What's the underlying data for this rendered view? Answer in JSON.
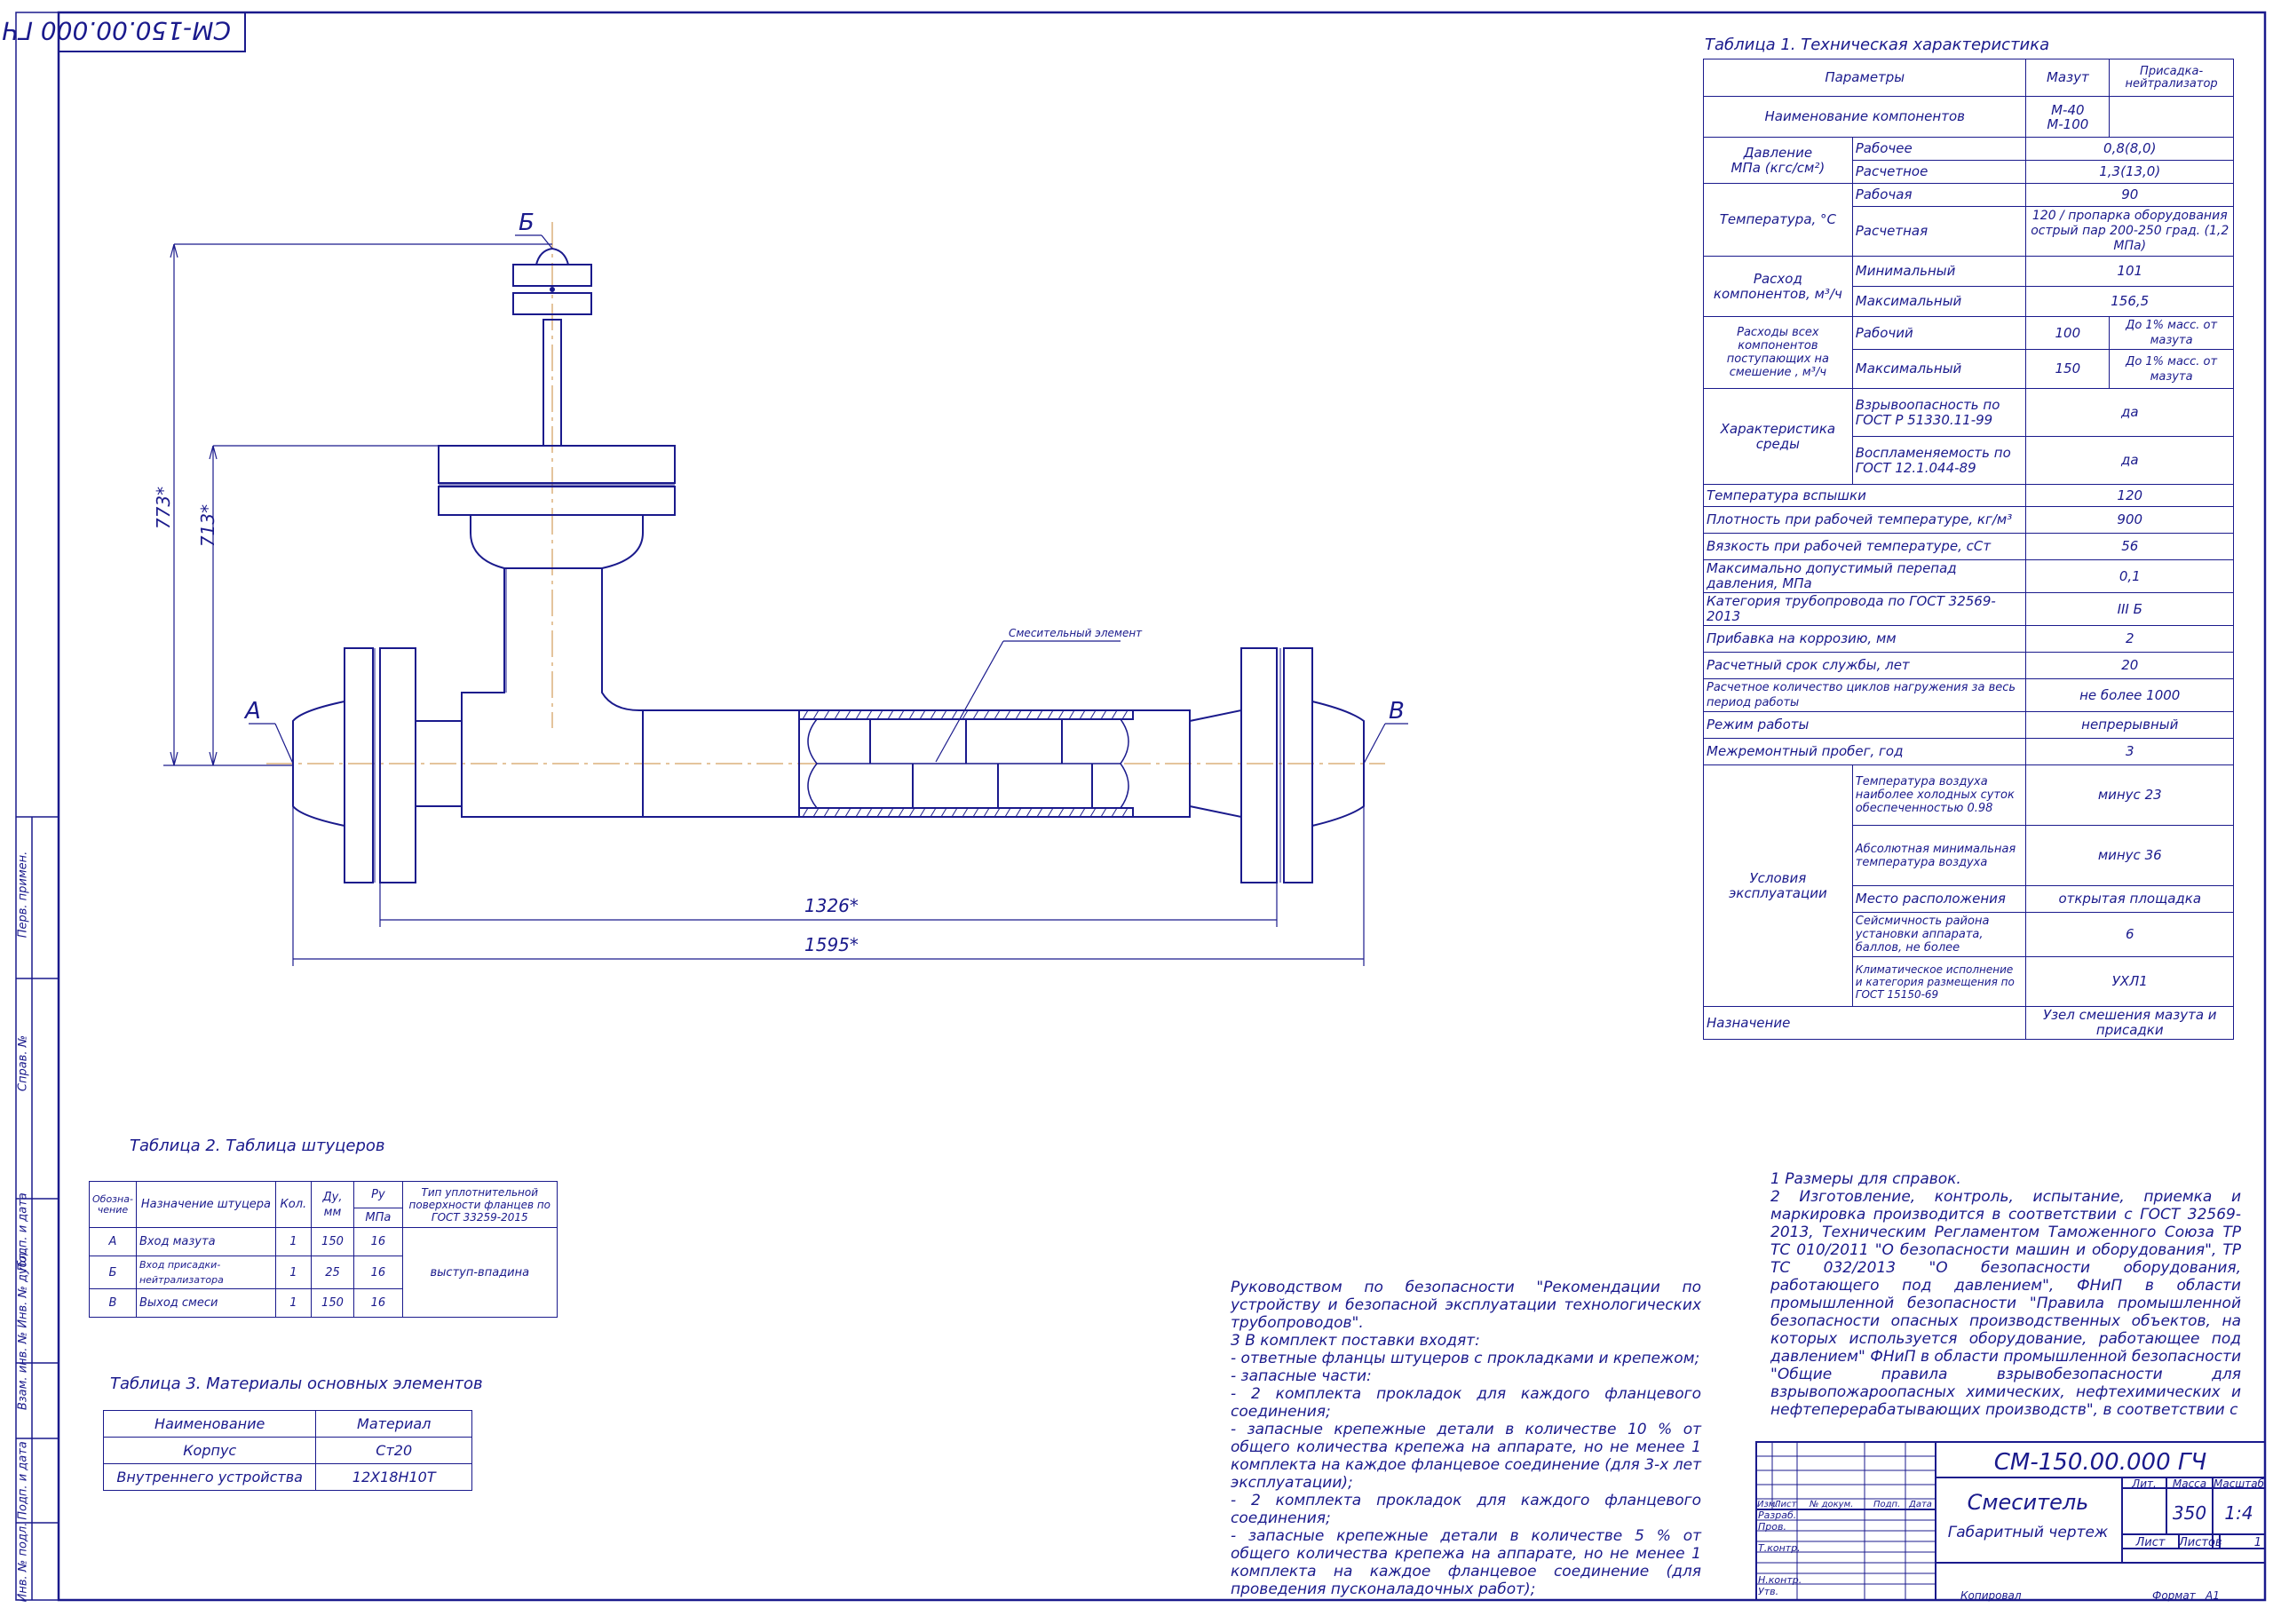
{
  "stamp_rotated": "СМ-150.00.000 ГЧ",
  "drawing": {
    "labels": {
      "a": "А",
      "b": "Б",
      "v": "В"
    },
    "dims": {
      "h1": "773*",
      "h2": "713*",
      "w1": "1326*",
      "w2": "1595*"
    },
    "leader": "Смесительный элемент"
  },
  "side_labels": [
    "Перв. примен.",
    "Справ. №",
    "Подп. и дата",
    "Взам. инв. № Инв. № дубл.",
    "Подп. и дата",
    "Инв. № подл."
  ],
  "table1": {
    "title": "Таблица 1. Техническая характеристика",
    "header": {
      "params": "Параметры",
      "mazut": "Мазут",
      "additive": "Присадка-нейтрализатор"
    },
    "components": {
      "label": "Наименование компонентов",
      "mazut": "М-40\nМ-100"
    },
    "pressure": {
      "label": "Давление\nМПа (кгс/см²)",
      "work": "Рабочее",
      "work_v": "0,8(8,0)",
      "calc": "Расчетное",
      "calc_v": "1,3(13,0)"
    },
    "temperature": {
      "label": "Температура, °С",
      "work": "Рабочая",
      "work_v": "90",
      "calc": "Расчетная",
      "calc_v": "120 / пропарка оборудования острый пар 200-250 град. (1,2 МПа)"
    },
    "flow": {
      "label": "Расход компонентов, м³/ч",
      "min": "Минимальный",
      "min_v": "101",
      "max": "Максимальный",
      "max_v": "156,5"
    },
    "flow_all": {
      "label": "Расходы всех компонентов поступающих на смешение , м³/ч",
      "work": "Рабочий",
      "work_m": "100",
      "work_a": "До 1% масс. от мазута",
      "max": "Максимальный",
      "max_m": "150",
      "max_a": "До 1% масс. от мазута"
    },
    "medium": {
      "label": "Характеристика среды",
      "explos": "Взрывоопасность по ГОСТ Р 51330.11-99",
      "explos_v": "да",
      "flam": "Воспламеняемость по ГОСТ 12.1.044-89",
      "flam_v": "да"
    },
    "rows": [
      {
        "label": "Температура вспышки",
        "value": "120",
        "green": true
      },
      {
        "label": "Плотность при рабочей температуре, кг/м³",
        "value": "900",
        "green": true
      },
      {
        "label": "Вязкость при рабочей температуре, сСт",
        "value": "56",
        "green": true
      },
      {
        "label": "Максимально допустимый перепад давления, МПа",
        "value": "0,1",
        "green": true
      },
      {
        "label": "Категория трубопровода по ГОСТ 32569-2013",
        "value": "III Б",
        "green": true
      },
      {
        "label": "Прибавка на коррозию, мм",
        "value": "2",
        "green": false
      },
      {
        "label": "Расчетный срок службы, лет",
        "value": "20",
        "green": false
      },
      {
        "label": "Расчетное количество циклов нагружения за весь период работы",
        "value": "не более 1000",
        "green": false
      },
      {
        "label": "Режим работы",
        "value": "непрерывный",
        "green": false
      },
      {
        "label": "Межремонтный пробег, год",
        "value": "3",
        "green": false
      }
    ],
    "conditions": {
      "label": "Условия эксплуатации",
      "items": [
        {
          "label": "Температура воздуха наиболее холодных суток обеспеченностью 0.98",
          "value": "минус 23",
          "green": false
        },
        {
          "label": "Абсолютная минимальная температура воздуха",
          "value": "минус 36",
          "green": false
        },
        {
          "label": "Место расположения",
          "value": "открытая площадка",
          "green": true
        },
        {
          "label": "Сейсмичность района установки аппарата, баллов, не более",
          "value": "6",
          "green": false
        },
        {
          "label": "Климатическое исполнение и категория размещения по ГОСТ 15150-69",
          "value": "УХЛ1",
          "green": false
        }
      ]
    },
    "purpose": {
      "label": "Назначение",
      "value": "Узел смешения мазута и присадки"
    }
  },
  "table2": {
    "title": "Таблица 2. Таблица штуцеров",
    "headers": {
      "code": "Обозна-чение",
      "name": "Назначение штуцера",
      "qty": "Кол.",
      "dn": "Ду, мм",
      "pn": "Ру",
      "pn_unit": "МПа",
      "type": "Тип уплотнительной поверхности фланцев по ГОСТ 33259-2015"
    },
    "rows": [
      {
        "code": "А",
        "name": "Вход мазута",
        "qty": "1",
        "dn": "150",
        "pn": "16"
      },
      {
        "code": "Б",
        "name": "Вход присадки-нейтрализатора",
        "qty": "1",
        "dn": "25",
        "pn": "16"
      },
      {
        "code": "В",
        "name": "Выход смеси",
        "qty": "1",
        "dn": "150",
        "pn": "16"
      }
    ],
    "type_value": "выступ-впадина"
  },
  "table3": {
    "title": "Таблица 3. Материалы основных элементов",
    "headers": {
      "name": "Наименование",
      "material": "Материал"
    },
    "rows": [
      {
        "name": "Корпус",
        "material": "Ст20"
      },
      {
        "name": "Внутреннего устройства",
        "material": "12Х18Н10Т"
      }
    ]
  },
  "notes_right": "1 Размеры для справок.\n2 Изготовление, контроль, испытание, приемка и маркировка производится в соответствии с ГОСТ 32569-2013, Техническим Регламентом Таможенного Союза ТР ТС 010/2011 \"О безопасности машин и оборудования\", ТР ТС 032/2013 \"О безопасности оборудования, работающего под давлением\", ФНиП в области промышленной безопасности \"Правила промышленной безопасности опасных производственных объектов, на которых используется оборудование, работающее под давлением\" ФНиП в области промышленной безопасности \"Общие правила взрывобезопасности для взрывопожароопасных химических, нефтехимических и нефтеперерабатывающих производств\", в соответствии с",
  "notes_middle": "Руководством по безопасности \"Рекомендации по устройству и безопасной эксплуатации технологических трубопроводов\".\n3 В комплект поставки входят:\n- ответные фланцы штуцеров с прокладками и крепежом;\n- запасные части:\n- 2 комплекта прокладок для каждого фланцевого соединения;\n- запасные крепежные детали в количестве 10 % от общего количества крепежа на аппарате, но не менее 1 комплекта на каждое фланцевое соединение (для 3-х лет эксплуатации);\n- 2 комплекта прокладок для каждого фланцевого соединения;\n- запасные крепежные детали в количестве 5 % от общего количества крепежа на аппарате, но не менее 1 комплекта на каждое фланцевое соединение (для проведения пусконаладочных работ);",
  "title_block": {
    "code": "СМ-150.00.000 ГЧ",
    "name": "Смеситель",
    "subtitle": "Габаритный чертеж",
    "lit": "Лит.",
    "mass_label": "Масса",
    "scale_label": "Масштаб",
    "mass": "350",
    "scale": "1:4",
    "sheet": "Лист",
    "sheets": "Листов",
    "sheets_v": "1",
    "cols": [
      "Изм.",
      "Лист",
      "№ докум.",
      "Подп.",
      "Дата"
    ],
    "roles": [
      "Разраб.",
      "Пров.",
      "Т.контр.",
      "",
      "Н.контр.",
      "Утв."
    ],
    "copied": "Копировал",
    "format_label": "Формат",
    "format": "А1"
  }
}
